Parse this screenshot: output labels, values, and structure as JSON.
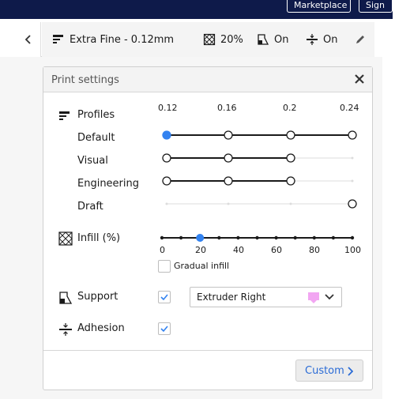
{
  "top_bar": {
    "marketplace_label": "Marketplace",
    "sign_in_label": "Sign"
  },
  "header": {
    "profile_label": "Extra Fine - 0.12mm",
    "infill_value": "20%",
    "support_value": "On",
    "adhesion_value": "On"
  },
  "print_settings": {
    "title": "Print settings",
    "profiles": {
      "label": "Profiles",
      "layer_heights": [
        "0.12",
        "0.16",
        "0.2",
        "0.24"
      ],
      "rows": [
        {
          "label": "Default",
          "available": [
            true,
            true,
            true,
            true
          ],
          "selected": "0.12"
        },
        {
          "label": "Visual",
          "available": [
            true,
            true,
            true,
            false
          ],
          "selected": null
        },
        {
          "label": "Engineering",
          "available": [
            true,
            true,
            true,
            false
          ],
          "selected": null
        },
        {
          "label": "Draft",
          "available": [
            false,
            false,
            false,
            true
          ],
          "selected": null
        }
      ]
    },
    "infill": {
      "label": "Infill (%)",
      "ticks": [
        "0",
        "20",
        "40",
        "60",
        "80",
        "100"
      ],
      "value": 20,
      "gradual_label": "Gradual infill",
      "gradual_checked": false
    },
    "support": {
      "label": "Support",
      "checked": true,
      "extruder": "Extruder Right",
      "extruder_color": "#f2a6f2"
    },
    "adhesion": {
      "label": "Adhesion",
      "checked": true
    },
    "custom_button_label": "Custom"
  },
  "colors": {
    "accent": "#3282f0",
    "link": "#2a6bd6",
    "navy": "#0e1a4a"
  }
}
